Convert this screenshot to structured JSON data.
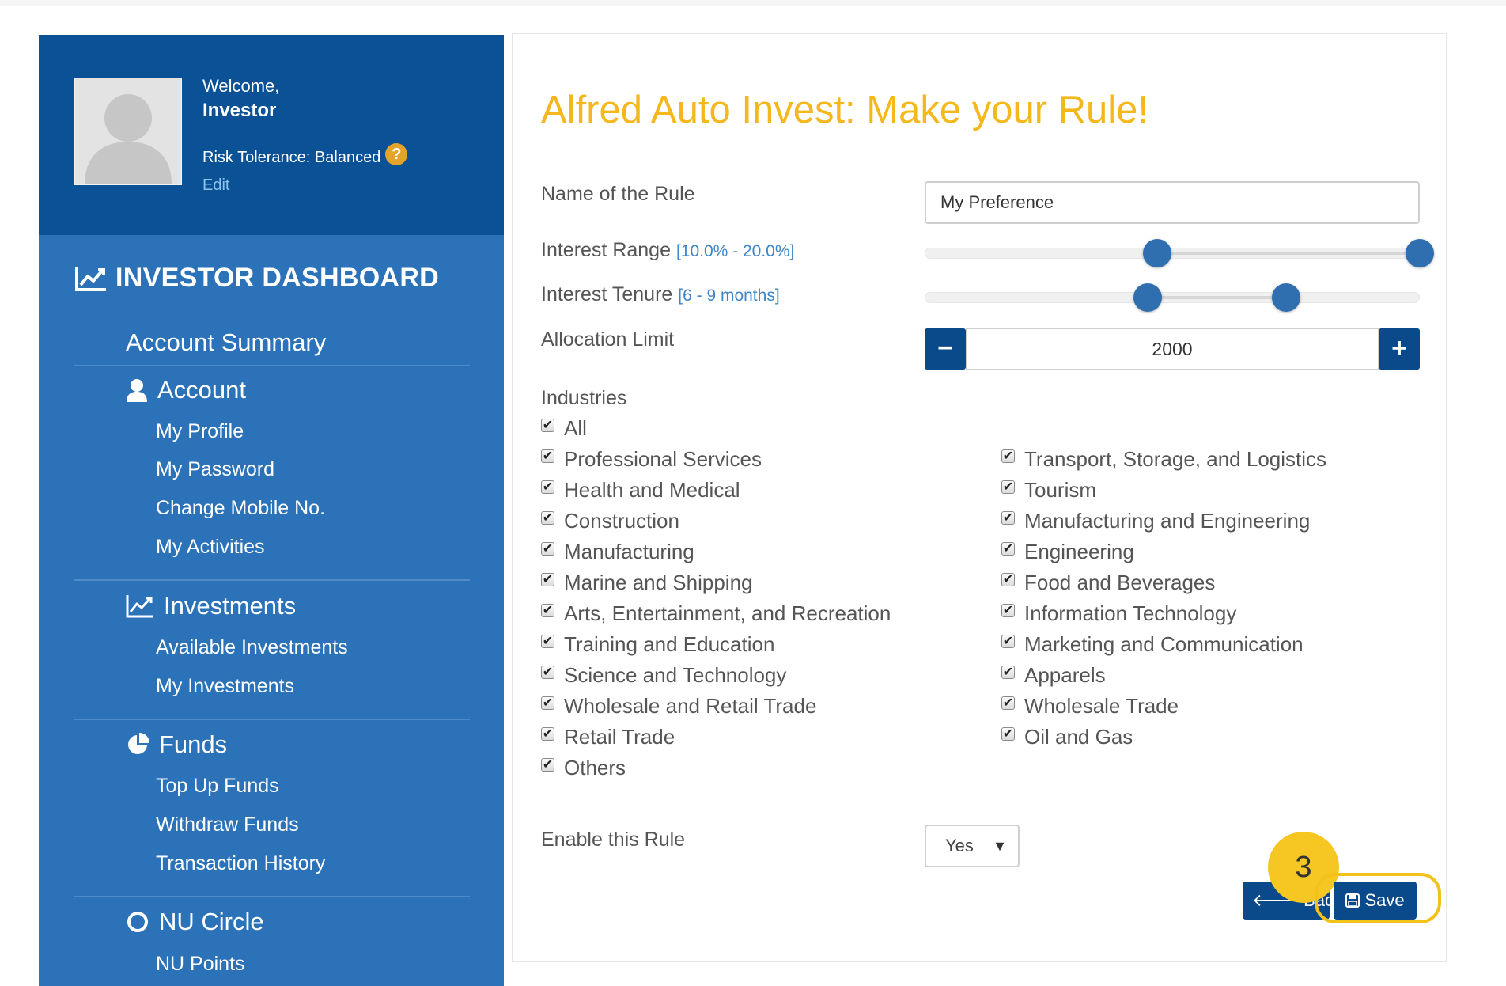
{
  "user": {
    "welcome": "Welcome,",
    "name": "Investor",
    "risk_tolerance": "Risk Tolerance: Balanced",
    "help": "?",
    "edit": "Edit"
  },
  "sidebar": {
    "title": "INVESTOR DASHBOARD",
    "account_summary": "Account Summary",
    "sections": {
      "account": {
        "label": "Account",
        "items": [
          "My Profile",
          "My Password",
          "Change Mobile No.",
          "My Activities"
        ]
      },
      "investments": {
        "label": "Investments",
        "items": [
          "Available Investments",
          "My Investments"
        ]
      },
      "funds": {
        "label": "Funds",
        "items": [
          "Top Up Funds",
          "Withdraw Funds",
          "Transaction History"
        ]
      },
      "nu_circle": {
        "label": "NU Circle",
        "items": [
          "NU Points"
        ]
      }
    }
  },
  "form": {
    "title": "Alfred Auto Invest: Make your Rule!",
    "rule_name_label": "Name of the Rule",
    "rule_name_value": "My Preference",
    "interest_range_label": "Interest Range",
    "interest_range_hint": "[10.0% - 20.0%]",
    "interest_range_low_pct": 47,
    "interest_range_high_pct": 100,
    "interest_tenure_label": "Interest Tenure",
    "interest_tenure_hint": "[6 - 9 months]",
    "interest_tenure_low_pct": 45,
    "interest_tenure_high_pct": 73,
    "allocation_label": "Allocation Limit",
    "allocation_minus": "−",
    "allocation_value": "2000",
    "allocation_plus": "+",
    "industries_label": "Industries",
    "industries_all": "All",
    "industries_left": [
      "Professional Services",
      "Health and Medical",
      "Construction",
      "Manufacturing",
      "Marine and Shipping",
      "Arts, Entertainment, and Recreation",
      "Training and Education",
      "Science and Technology",
      "Wholesale and Retail Trade",
      "Retail Trade",
      "Others"
    ],
    "industries_right": [
      "Transport, Storage, and Logistics",
      "Tourism",
      "Manufacturing and Engineering",
      "Engineering",
      "Food and Beverages",
      "Information Technology",
      "Marketing and Communication",
      "Apparels",
      "Wholesale Trade",
      "Oil and Gas"
    ],
    "checked_mark": "✔",
    "enable_label": "Enable this Rule",
    "enable_value": "Yes",
    "enable_arrow": "▼",
    "back_button": "Back",
    "save_button": "Save",
    "step_badge": "3"
  },
  "colors": {
    "sidebar_bg": "#2b72b8",
    "user_panel_bg": "#0a5196",
    "title_color": "#f5b81c",
    "button_bg": "#0b4a8a",
    "highlight": "#f2c21b"
  }
}
